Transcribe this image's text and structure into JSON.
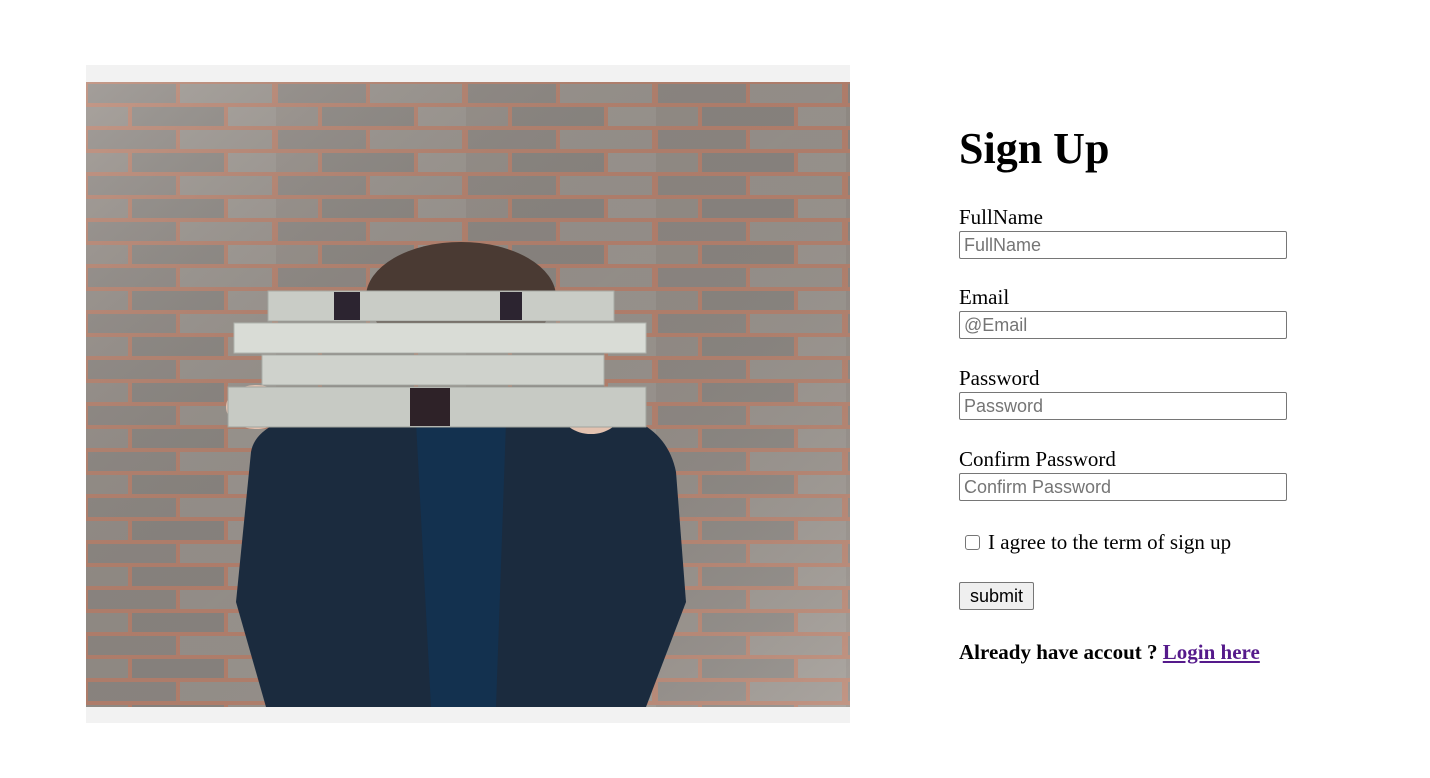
{
  "signup": {
    "title": "Sign Up",
    "fields": [
      {
        "label": "FullName",
        "placeholder": "FullName"
      },
      {
        "label": "Email",
        "placeholder": "@Email"
      },
      {
        "label": "Password",
        "placeholder": "Password"
      },
      {
        "label": "Confirm Password",
        "placeholder": "Confirm Password"
      }
    ],
    "agree_label": "I agree to the term of sign up",
    "agree_checked": false,
    "submit_label": "submit",
    "login_prompt": "Already have accout ?",
    "login_link": "Login here"
  },
  "colors": {
    "link": "#551a8b",
    "image_panel_bg": "#f2f2f2"
  }
}
